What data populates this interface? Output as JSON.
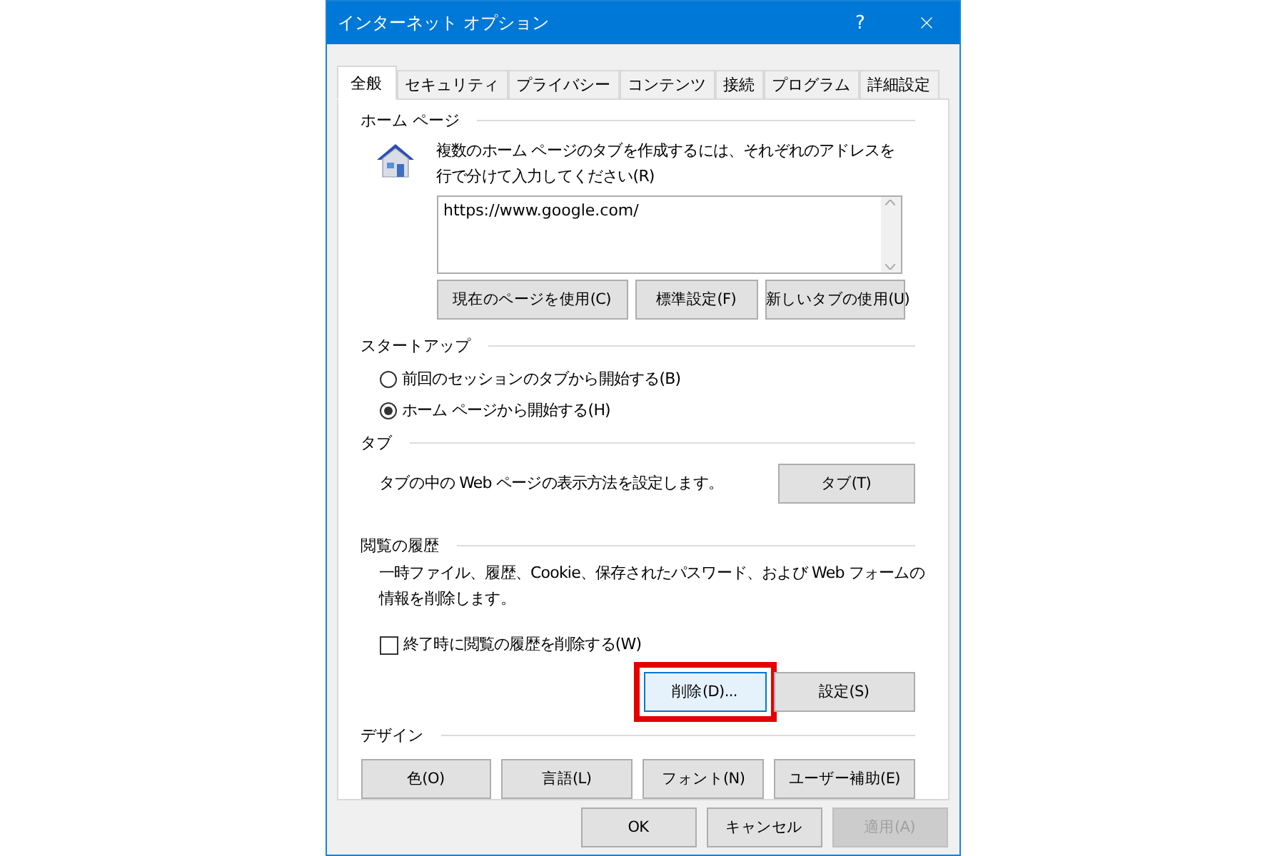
{
  "window": {
    "title": "インターネット オプション",
    "help": "?"
  },
  "tabs": [
    {
      "label": "全般",
      "selected": true
    },
    {
      "label": "セキュリティ",
      "selected": false
    },
    {
      "label": "プライバシー",
      "selected": false
    },
    {
      "label": "コンテンツ",
      "selected": false
    },
    {
      "label": "接続",
      "selected": false
    },
    {
      "label": "プログラム",
      "selected": false
    },
    {
      "label": "詳細設定",
      "selected": false
    }
  ],
  "home_page": {
    "heading": "ホーム ページ",
    "description": "複数のホーム ページのタブを作成するには、それぞれのアドレスを行で分けて入力してください(R)",
    "value": "https://www.google.com/",
    "buttons": [
      {
        "label": "現在のページを使用(C)"
      },
      {
        "label": "標準設定(F)"
      },
      {
        "label": "新しいタブの使用(U)"
      }
    ]
  },
  "startup": {
    "heading": "スタートアップ",
    "options": [
      {
        "label": "前回のセッションのタブから開始する(B)",
        "selected": false
      },
      {
        "label": "ホーム ページから開始する(H)",
        "selected": true
      }
    ]
  },
  "tabs_section": {
    "heading": "タブ",
    "description": "タブの中の Web ページの表示方法を設定します。",
    "button": "タブ(T)"
  },
  "history": {
    "heading": "閲覧の履歴",
    "description": "一時ファイル、履歴、Cookie、保存されたパスワード、および Web フォームの情報を削除します。",
    "checkbox": {
      "label": "終了時に閲覧の履歴を削除する(W)",
      "checked": false
    },
    "buttons": [
      {
        "label": "削除(D)...",
        "highlighted": true
      },
      {
        "label": "設定(S)",
        "highlighted": false
      }
    ]
  },
  "design": {
    "heading": "デザイン",
    "buttons": [
      {
        "label": "色(O)"
      },
      {
        "label": "言語(L)"
      },
      {
        "label": "フォント(N)"
      },
      {
        "label": "ユーザー補助(E)"
      }
    ]
  },
  "footer": [
    {
      "label": "OK",
      "disabled": false
    },
    {
      "label": "キャンセル",
      "disabled": false
    },
    {
      "label": "適用(A)",
      "disabled": true
    }
  ]
}
